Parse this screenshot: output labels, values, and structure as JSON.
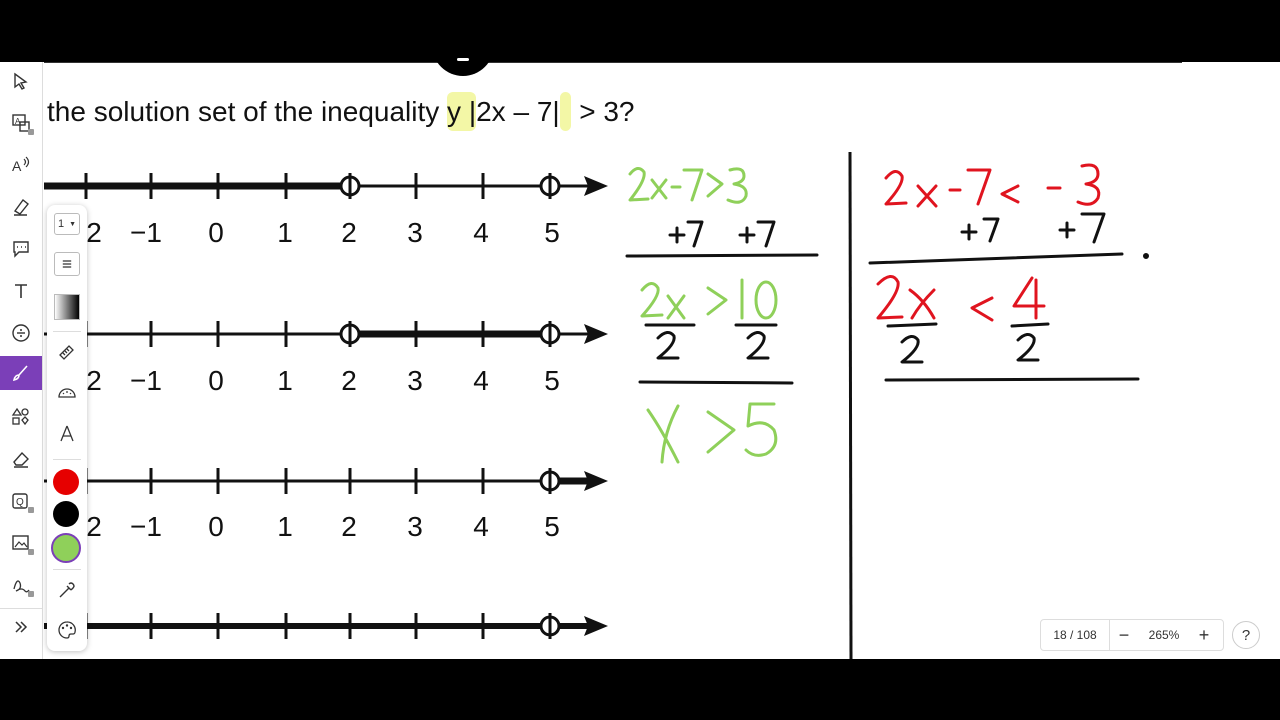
{
  "question": {
    "prefix": "the solution set of the inequality ",
    "hl1": "y |",
    "mid": "2x – 7|",
    "after": " > 3?"
  },
  "number_lines": [
    {
      "labels": [
        "2",
        "−1",
        "0",
        "1",
        "2",
        "3",
        "4",
        "5"
      ]
    },
    {
      "labels": [
        "2",
        "−1",
        "0",
        "1",
        "2",
        "3",
        "4",
        "5"
      ]
    },
    {
      "labels": [
        "2",
        "−1",
        "0",
        "1",
        "2",
        "3",
        "4",
        "5"
      ]
    }
  ],
  "pen_tray": {
    "size_value": "1"
  },
  "colors": {
    "accent": "#7b3fb8",
    "swatches": [
      "#e60000",
      "#000000",
      "#8fd05a"
    ],
    "green_ink": "#8fd05a",
    "red_ink": "#e0141f"
  },
  "pager": {
    "page": "18 / 108",
    "minus": "−",
    "zoom": "265%",
    "plus": "+",
    "help": "?"
  }
}
